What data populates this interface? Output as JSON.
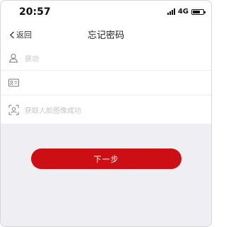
{
  "status_bar": {
    "time": "20:57",
    "network": "4G"
  },
  "nav": {
    "back_label": "返回",
    "title": "忘记密码"
  },
  "form": {
    "rows": [
      {
        "icon": "user-icon",
        "text": "获功"
      },
      {
        "icon": "id-card-icon",
        "text": ""
      },
      {
        "icon": "face-scan-icon",
        "text": "获取人脸图像成功"
      }
    ]
  },
  "actions": {
    "next_label": "下一步"
  },
  "colors": {
    "accent": "#cc0f14",
    "background": "#efeef2"
  }
}
